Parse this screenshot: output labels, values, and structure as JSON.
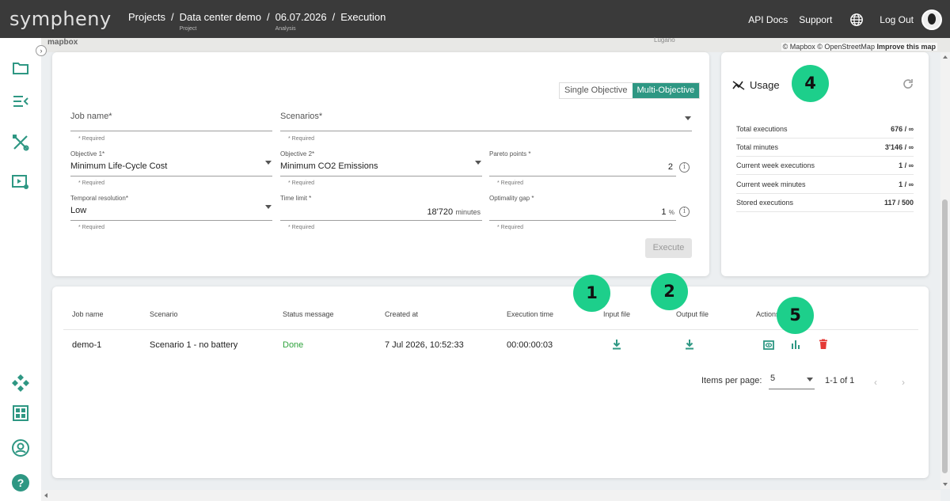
{
  "app": {
    "logo": "sympheny"
  },
  "breadcrumb": [
    {
      "label": "Projects",
      "sub": ""
    },
    {
      "label": "Data center demo",
      "sub": "Project"
    },
    {
      "label": "06.07.2026",
      "sub": "Analysis"
    },
    {
      "label": "Execution",
      "sub": ""
    }
  ],
  "topnav": {
    "api_docs": "API Docs",
    "support": "Support",
    "logout": "Log Out"
  },
  "map": {
    "brand": "mapbox",
    "place": "Lugano",
    "attribution": "© Mapbox © OpenStreetMap",
    "improve": "Improve this map"
  },
  "form": {
    "toggle": {
      "single": "Single Objective",
      "multi": "Multi-Objective",
      "selected": "Multi-Objective"
    },
    "job_name": {
      "label": "Job name*",
      "value": "",
      "hint": "* Required"
    },
    "scenarios": {
      "label": "Scenarios*",
      "value": "",
      "hint": "* Required"
    },
    "objective1": {
      "label": "Objective 1*",
      "value": "Minimum Life-Cycle Cost",
      "hint": "* Required"
    },
    "objective2": {
      "label": "Objective 2*",
      "value": "Minimum CO2 Emissions",
      "hint": "* Required"
    },
    "pareto": {
      "label": "Pareto points *",
      "value": "2",
      "hint": "* Required"
    },
    "temporal": {
      "label": "Temporal resolution*",
      "value": "Low",
      "hint": "* Required"
    },
    "time_limit": {
      "label": "Time limit *",
      "value": "18'720",
      "unit": "minutes",
      "hint": "* Required"
    },
    "optimality": {
      "label": "Optimality gap *",
      "value": "1",
      "unit": "%",
      "hint": "* Required"
    },
    "execute": "Execute"
  },
  "usage": {
    "title": "Usage",
    "rows": [
      {
        "label": "Total executions",
        "value": "676 / ∞"
      },
      {
        "label": "Total minutes",
        "value": "3'146 / ∞"
      },
      {
        "label": "Current week executions",
        "value": "1 / ∞"
      },
      {
        "label": "Current week minutes",
        "value": "1 / ∞"
      },
      {
        "label": "Stored executions",
        "value": "117 / 500"
      }
    ]
  },
  "badges": [
    "1",
    "2",
    "4",
    "5"
  ],
  "table": {
    "headers": [
      "Job name",
      "Scenario",
      "Status message",
      "Created at",
      "Execution time",
      "Input file",
      "Output file",
      "Actions"
    ],
    "rows": [
      {
        "job": "demo-1",
        "scenario": "Scenario 1 - no battery",
        "status": "Done",
        "created": "7 Jul 2026, 10:52:33",
        "exec_time": "00:00:00:03"
      }
    ]
  },
  "pager": {
    "label": "Items per page:",
    "size": "5",
    "range": "1-1 of 1"
  },
  "colors": {
    "accent": "#2e9783",
    "badge": "#1dcf8b",
    "topbar": "#3a3a3a",
    "delete": "#e53935",
    "done": "#2fa33d"
  }
}
